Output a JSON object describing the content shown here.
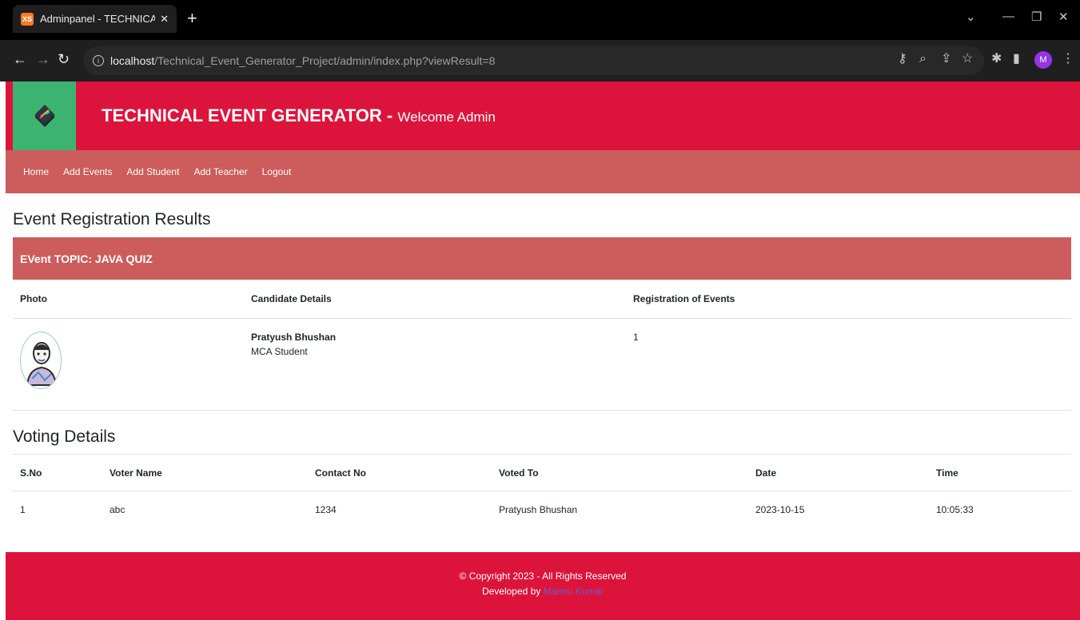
{
  "browser": {
    "tab_title": "Adminpanel - TECHNICAL EVEN",
    "favicon_text": "XS",
    "url_host": "localhost",
    "url_path": "/Technical_Event_Generator_Project/admin/index.php?viewResult=8",
    "profile_initial": "M"
  },
  "header": {
    "title": "TECHNICAL EVENT GENERATOR -",
    "subtitle": "Welcome Admin",
    "color": "#dc143c",
    "logo_bg": "#3cb371"
  },
  "nav": {
    "items": [
      {
        "label": "Home"
      },
      {
        "label": "Add Events"
      },
      {
        "label": "Add Student"
      },
      {
        "label": "Add Teacher"
      },
      {
        "label": "Logout"
      }
    ],
    "color": "#cd5c5c"
  },
  "results": {
    "title": "Event Registration Results",
    "topic": "EVent TOPIC: JAVA QUIZ",
    "columns": [
      "Photo",
      "Candidate Details",
      "Registration of Events"
    ],
    "rows": [
      {
        "name": "Pratyush Bhushan",
        "role": "MCA Student",
        "registrations": "1"
      }
    ]
  },
  "voting": {
    "title": "Voting Details",
    "columns": [
      "S.No",
      "Voter Name",
      "Contact No",
      "Voted To",
      "Date",
      "Time"
    ],
    "rows": [
      [
        "1",
        "abc",
        "1234",
        "Pratyush Bhushan",
        "2023-10-15",
        "10:05:33"
      ]
    ]
  },
  "footer": {
    "copyright": "© Copyright 2023 - All Rights Reserved",
    "developed_by": "Developed by",
    "developer": "Mannu Kumar"
  }
}
